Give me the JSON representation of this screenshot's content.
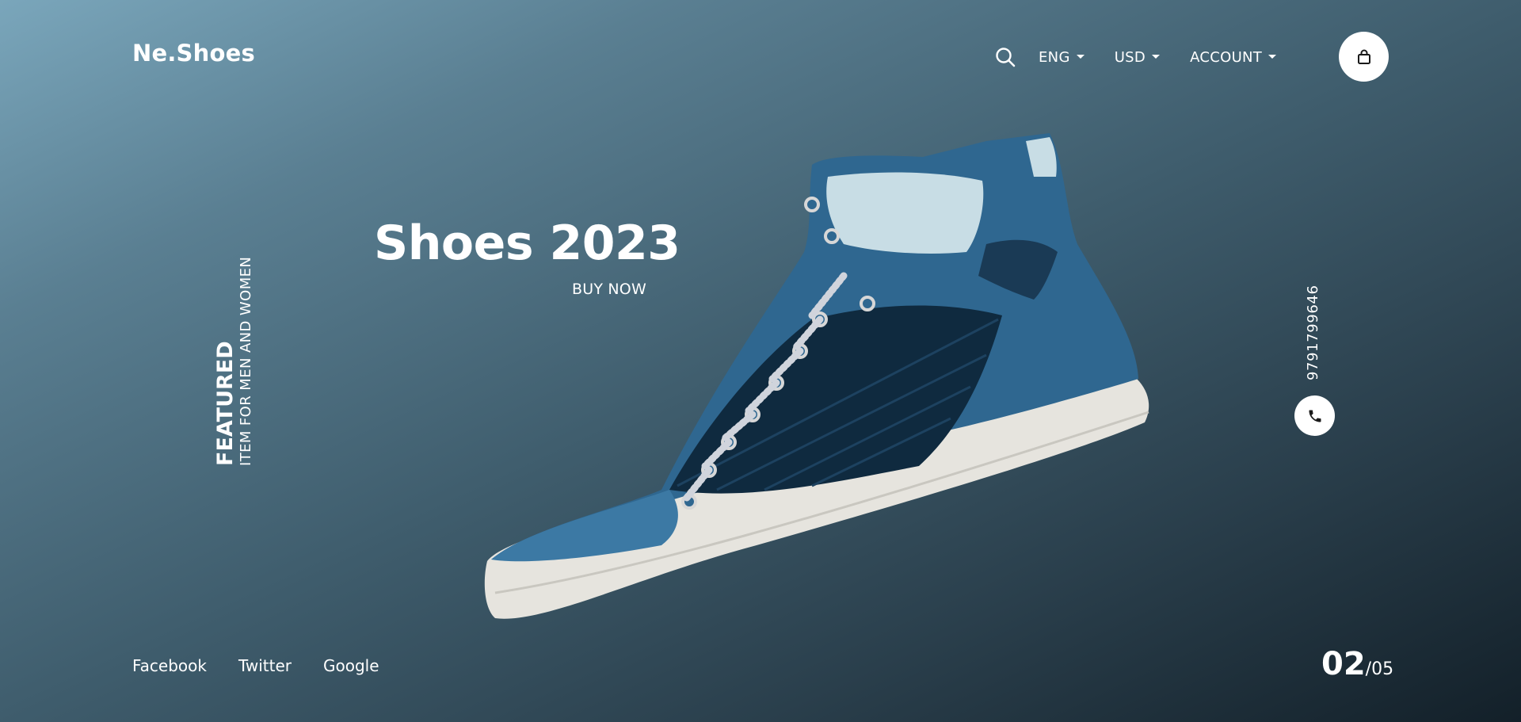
{
  "brand": {
    "logo": "Ne.Shoes"
  },
  "nav": {
    "language": "ENG",
    "currency": "USD",
    "account": "ACCOUNT"
  },
  "hero": {
    "title": "Shoes 2023",
    "cta": "BUY NOW"
  },
  "featured": {
    "title": "FEATURED",
    "subtitle": "ITEM FOR MEN AND WOMEN"
  },
  "contact": {
    "phone": "9791799646"
  },
  "social": {
    "facebook": "Facebook",
    "twitter": "Twitter",
    "google": "Google"
  },
  "slider": {
    "current": "02",
    "separator": "/",
    "total": "05"
  },
  "colors": {
    "text": "#ffffff",
    "shoe_upper": "#2f6790",
    "shoe_mesh": "#0f2a3f",
    "sole": "#e6e4de"
  },
  "icons": {
    "search": "search-icon",
    "cart": "shopping-bag-icon",
    "phone": "phone-icon"
  }
}
